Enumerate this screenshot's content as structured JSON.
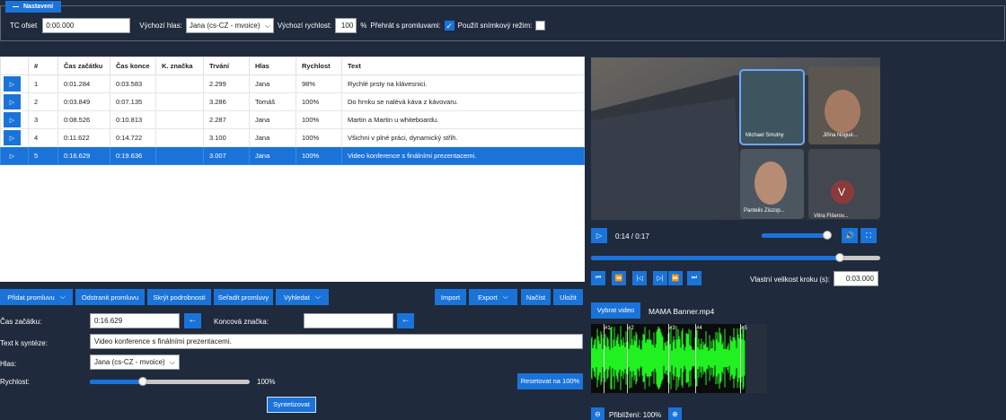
{
  "settings": {
    "legend": "Nastavení",
    "tc_offset_label": "TC ofset",
    "tc_offset_value": "0:00.000",
    "default_voice_label": "Výchozí hlas:",
    "default_voice_value": "Jana (cs-CZ - mvoice)",
    "default_speed_label": "Výchozí rychlost:",
    "default_speed_value": "100",
    "percent": "%",
    "play_with_utterances_label": "Přehrát s promluvami:",
    "play_with_utterances_checked": true,
    "frame_mode_label": "Použít snímkový režim:",
    "frame_mode_checked": false
  },
  "table": {
    "headers": [
      "",
      "#",
      "Čas začátku",
      "Čas konce",
      "K. značka",
      "Trvání",
      "Hlas",
      "Rychlost",
      "Text"
    ],
    "rows": [
      {
        "num": "1",
        "start": "0:01.284",
        "end": "0:03.583",
        "mark": "",
        "duration": "2.299",
        "voice": "Jana",
        "speed": "98%",
        "text": "Rychlé prsty na klávesnici.",
        "selected": false
      },
      {
        "num": "2",
        "start": "0:03.849",
        "end": "0:07.135",
        "mark": "",
        "duration": "3.286",
        "voice": "Tomáš",
        "speed": "100%",
        "text": "Do hrnku se nalévá káva z kávovaru.",
        "selected": false
      },
      {
        "num": "3",
        "start": "0:08.526",
        "end": "0:10.813",
        "mark": "",
        "duration": "2.287",
        "voice": "Jana",
        "speed": "100%",
        "text": "Martin a Martin u whiteboardu.",
        "selected": false
      },
      {
        "num": "4",
        "start": "0:11.622",
        "end": "0:14.722",
        "mark": "",
        "duration": "3.100",
        "voice": "Jana",
        "speed": "100%",
        "text": "Všichni v plné práci, dynamický střih.",
        "selected": false
      },
      {
        "num": "5",
        "start": "0:16.629",
        "end": "0:19.636",
        "mark": "",
        "duration": "3.007",
        "voice": "Jana",
        "speed": "100%",
        "text": "Video konference s finálními prezentacemi.",
        "selected": true
      }
    ]
  },
  "toolbar": {
    "add_utterance": "Přidat promluvu",
    "remove_utterance": "Odstranit promluvu",
    "hide_details": "Skrýt podrobnosti",
    "sort_utterances": "Seřadit promluvy",
    "search": "Vyhledat",
    "import": "Import",
    "export": "Export",
    "load": "Načíst",
    "save": "Uložit"
  },
  "editor": {
    "start_label": "Čas začátku:",
    "start_value": "0:16.629",
    "end_mark_label": "Koncová značka:",
    "end_mark_value": "",
    "text_label": "Text k syntéze:",
    "text_value": "Video konference s finálními prezentacemi.",
    "voice_label": "Hlas:",
    "voice_value": "Jana (cs-CZ - mvoice)",
    "speed_label": "Rychlost:",
    "speed_value": "100%",
    "speed_level": 0.33,
    "reset_button": "Resetovat na 100%",
    "synthesize_button": "Syntetizovat"
  },
  "video": {
    "time": "0:14 / 0:17",
    "volume_level": 0.98,
    "progress": 0.86,
    "participants": [
      "Michael Smutny",
      "Jiřina Nogué...",
      "Pantelis Ziszop...",
      "Věra Fišerov..."
    ],
    "avatar_letter": "V",
    "step_label": "Vlastní velikost kroku (s):",
    "step_value": "0:03.000",
    "select_video": "Vybrat video",
    "file_name": "MAMA Banner.mp4"
  },
  "waveform": {
    "markers": [
      "#1",
      "#2",
      "#3",
      "#4",
      "#5"
    ],
    "zoom_label": "Přiblížení: 100%"
  },
  "colors": {
    "accent": "#1a73d9",
    "background": "#1f2a3c",
    "wave": "#21f021"
  }
}
